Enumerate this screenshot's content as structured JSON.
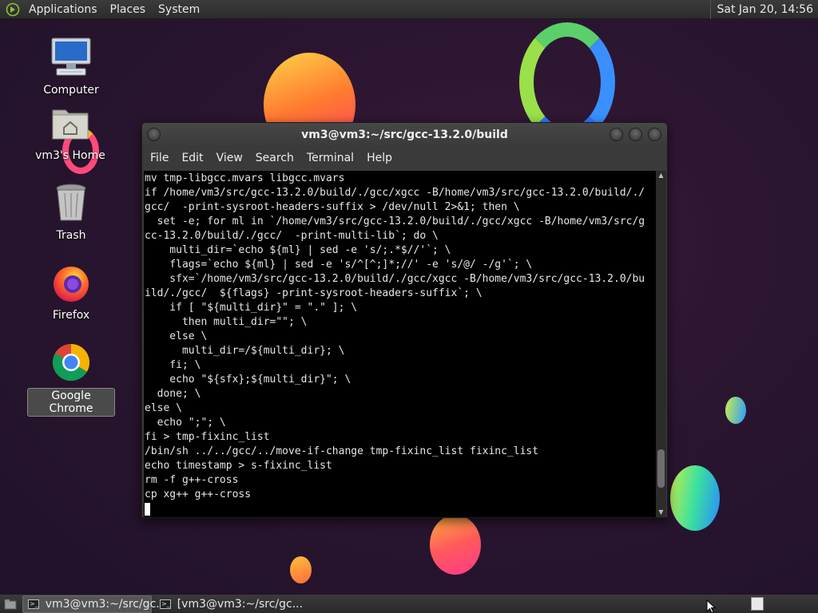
{
  "top_panel": {
    "menus": [
      "Applications",
      "Places",
      "System"
    ],
    "clock": "Sat Jan 20, 14:56"
  },
  "desktop_icons": [
    {
      "label": "Computer",
      "icon": "computer-icon"
    },
    {
      "label": "vm3's Home",
      "icon": "home-folder-icon"
    },
    {
      "label": "Trash",
      "icon": "trash-icon"
    },
    {
      "label": "Firefox",
      "icon": "firefox-icon"
    },
    {
      "label": "Google Chrome",
      "icon": "chrome-icon",
      "selected": true
    }
  ],
  "terminal": {
    "title": "vm3@vm3:~/src/gcc-13.2.0/build",
    "menus": [
      "File",
      "Edit",
      "View",
      "Search",
      "Terminal",
      "Help"
    ],
    "lines": [
      "mv tmp-libgcc.mvars libgcc.mvars",
      "if /home/vm3/src/gcc-13.2.0/build/./gcc/xgcc -B/home/vm3/src/gcc-13.2.0/build/./",
      "gcc/  -print-sysroot-headers-suffix > /dev/null 2>&1; then \\",
      "  set -e; for ml in `/home/vm3/src/gcc-13.2.0/build/./gcc/xgcc -B/home/vm3/src/g",
      "cc-13.2.0/build/./gcc/  -print-multi-lib`; do \\",
      "    multi_dir=`echo ${ml} | sed -e 's/;.*$//'`; \\",
      "    flags=`echo ${ml} | sed -e 's/^[^;]*;//' -e 's/@/ -/g'`; \\",
      "    sfx=`/home/vm3/src/gcc-13.2.0/build/./gcc/xgcc -B/home/vm3/src/gcc-13.2.0/bu",
      "ild/./gcc/  ${flags} -print-sysroot-headers-suffix`; \\",
      "    if [ \"${multi_dir}\" = \".\" ]; \\",
      "      then multi_dir=\"\"; \\",
      "    else \\",
      "      multi_dir=/${multi_dir}; \\",
      "    fi; \\",
      "    echo \"${sfx};${multi_dir}\"; \\",
      "  done; \\",
      "else \\",
      "  echo \";\"; \\",
      "fi > tmp-fixinc_list",
      "/bin/sh ../../gcc/../move-if-change tmp-fixinc_list fixinc_list",
      "echo timestamp > s-fixinc_list",
      "rm -f g++-cross",
      "cp xg++ g++-cross"
    ],
    "scroll_position": 0.93
  },
  "taskbar": {
    "tasks": [
      {
        "label": "vm3@vm3:~/src/gc...",
        "active": true
      },
      {
        "label": "[vm3@vm3:~/src/gc...",
        "active": false
      }
    ]
  },
  "colors": {
    "panel": "#2f2f2f",
    "terminal_bg": "#000000",
    "terminal_fg": "#e6e6e6"
  }
}
